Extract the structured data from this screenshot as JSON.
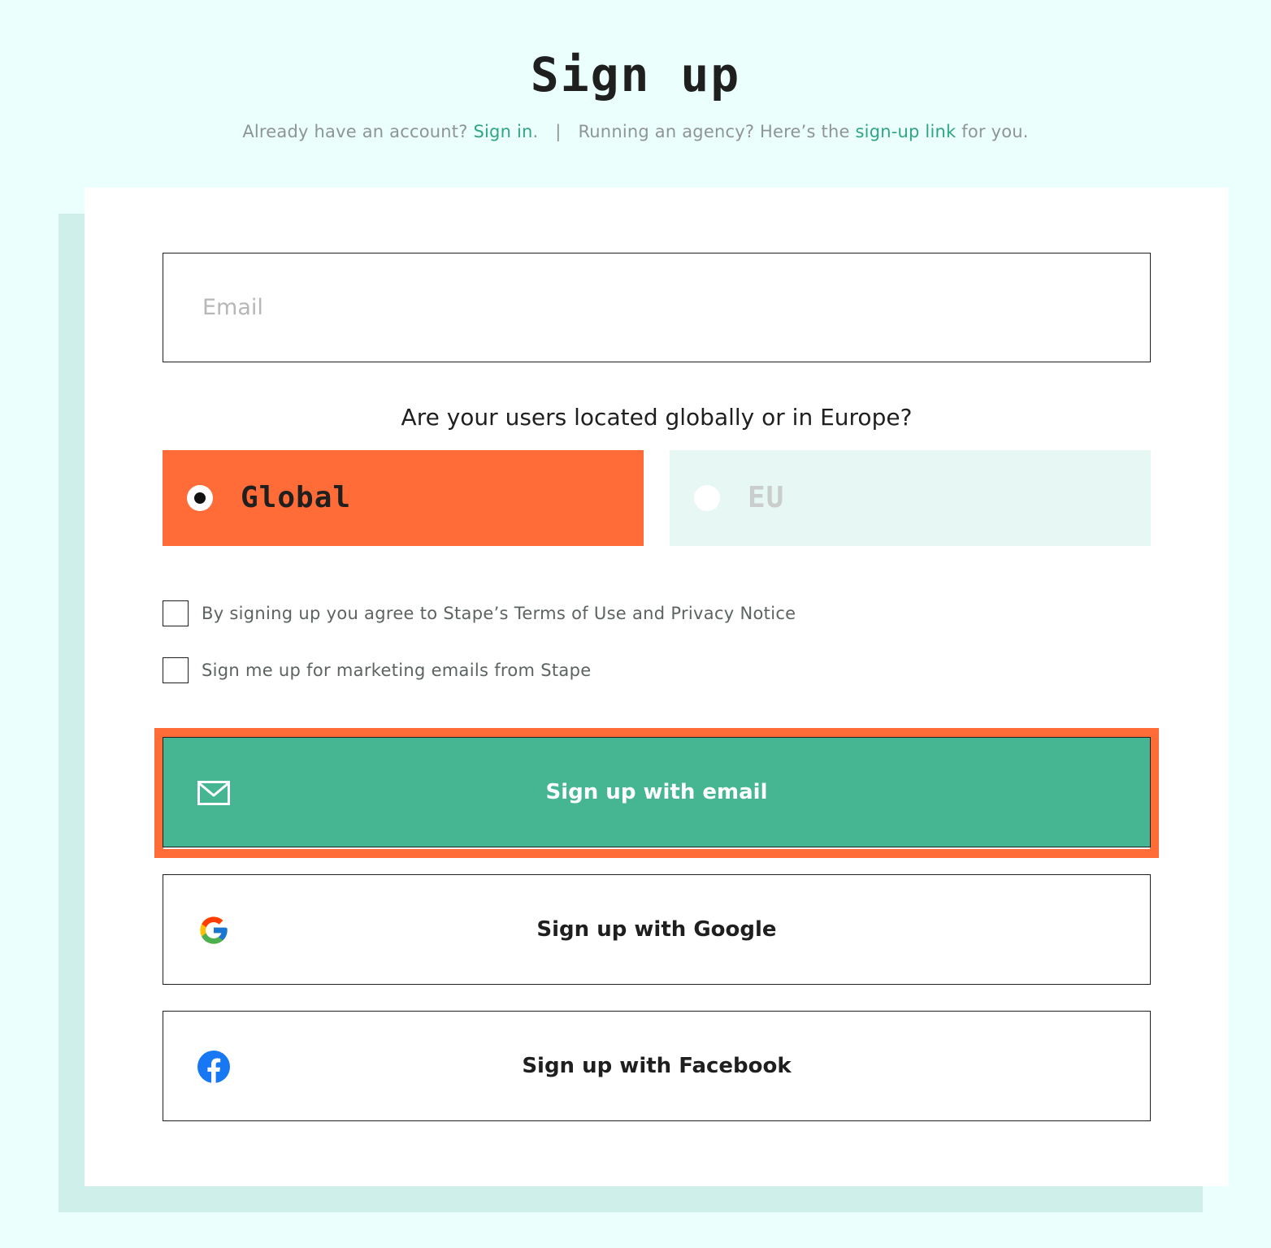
{
  "header": {
    "title": "Sign up",
    "subtitle": {
      "already_text": "Already have an account?",
      "sign_in_link": "Sign in",
      "period_1": ".",
      "separator": "|",
      "agency_text": "Running an agency? Here’s the",
      "agency_link": "sign-up link",
      "agency_suffix": "for you."
    }
  },
  "form": {
    "email": {
      "placeholder": "Email",
      "value": ""
    },
    "region": {
      "question": "Are your users located globally or in Europe?",
      "options": [
        {
          "label": "Global",
          "selected": true
        },
        {
          "label": "EU",
          "selected": false
        }
      ]
    },
    "consents": {
      "terms": {
        "label": "By signing up you agree to Stape’s Terms of Use and Privacy Notice",
        "checked": false
      },
      "marketing": {
        "label": "Sign me up for marketing emails from Stape",
        "checked": false
      }
    },
    "buttons": {
      "email": {
        "label": "Sign up with email",
        "icon": "mail-icon"
      },
      "google": {
        "label": "Sign up with Google",
        "icon": "google-icon"
      },
      "facebook": {
        "label": "Sign up with Facebook",
        "icon": "facebook-icon"
      }
    }
  },
  "colors": {
    "background": "#ebfffd",
    "accent_orange": "#ff6c37",
    "primary_green": "#46b692",
    "link_green": "#2fa583",
    "eu_option_bg": "#e7f7f3",
    "card_shadow": "#cfefeb"
  }
}
